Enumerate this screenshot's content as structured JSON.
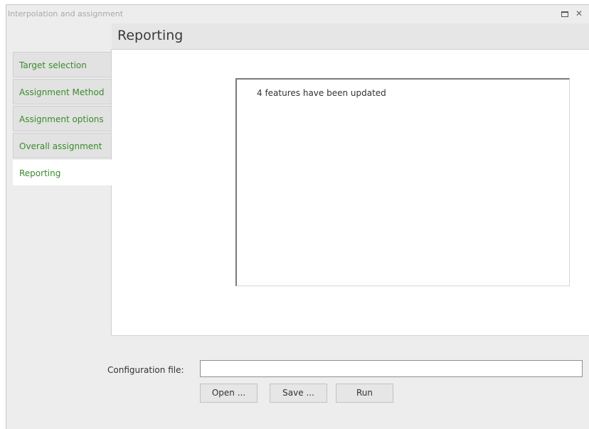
{
  "window": {
    "title": "Interpolation and assignment"
  },
  "page": {
    "title": "Reporting"
  },
  "tabs": [
    {
      "label": "Target selection",
      "active": false
    },
    {
      "label": "Assignment Method",
      "active": false
    },
    {
      "label": "Assignment options",
      "active": false
    },
    {
      "label": "Overall assignment",
      "active": false
    },
    {
      "label": "Reporting",
      "active": true
    }
  ],
  "report": {
    "message": "4 features have been updated"
  },
  "config": {
    "label": "Configuration file:",
    "value": "",
    "placeholder": ""
  },
  "buttons": {
    "open": "Open ...",
    "save": "Save ...",
    "run": "Run"
  },
  "colors": {
    "tab_text": "#3a8b2c",
    "window_bg": "#ededed"
  }
}
